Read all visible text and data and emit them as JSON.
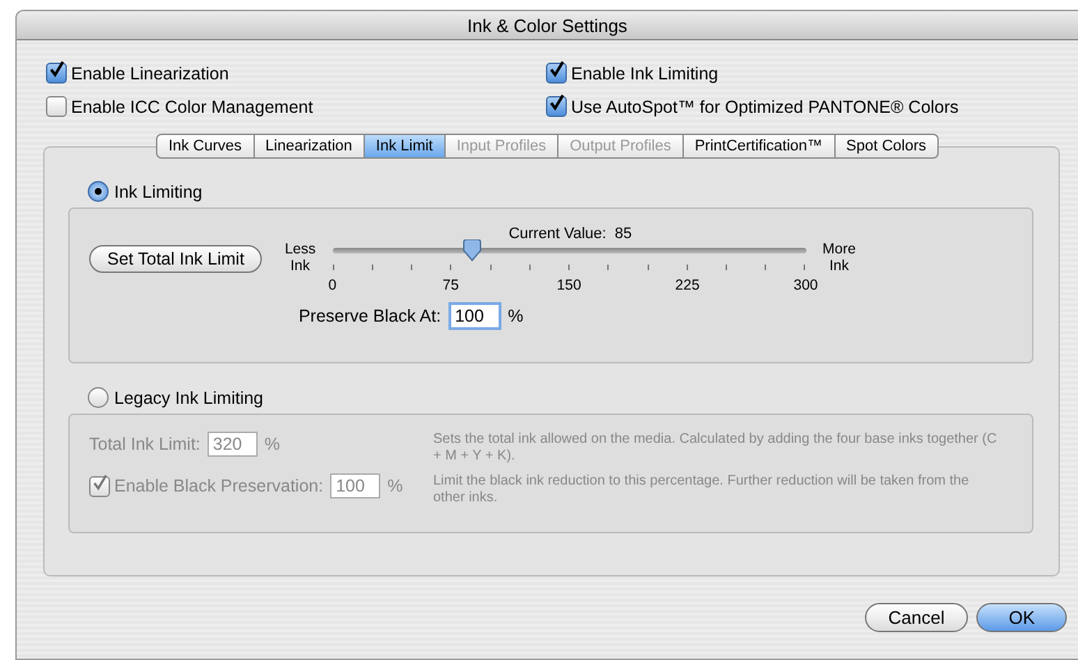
{
  "window": {
    "title": "Ink & Color Settings"
  },
  "options": [
    {
      "label": "Enable Linearization",
      "checked": true
    },
    {
      "label": "Enable Ink Limiting",
      "checked": true
    },
    {
      "label": "Enable ICC Color Management",
      "checked": false
    },
    {
      "label": "Use AutoSpot™ for Optimized PANTONE® Colors",
      "checked": true
    }
  ],
  "tabs": [
    {
      "label": "Ink Curves",
      "selected": false,
      "disabled": false
    },
    {
      "label": "Linearization",
      "selected": false,
      "disabled": false
    },
    {
      "label": "Ink Limit",
      "selected": true,
      "disabled": false
    },
    {
      "label": "Input Profiles",
      "selected": false,
      "disabled": true
    },
    {
      "label": "Output Profiles",
      "selected": false,
      "disabled": true
    },
    {
      "label": "PrintCertification™",
      "selected": false,
      "disabled": false
    },
    {
      "label": "Spot Colors",
      "selected": false,
      "disabled": false
    }
  ],
  "ink_limiting": {
    "label": "Ink Limiting",
    "selected": true,
    "button": "Set Total Ink Limit",
    "current_label": "Current Value:",
    "current_value": "85",
    "less_label": [
      "Less",
      "Ink"
    ],
    "more_label": [
      "More",
      "Ink"
    ],
    "slider": {
      "level": 0.283
    },
    "tick_labels": [
      "0",
      "75",
      "150",
      "225",
      "300"
    ],
    "preserve_label": "Preserve Black At:",
    "preserve_value": "100",
    "preserve_unit": "%"
  },
  "legacy": {
    "label": "Legacy Ink Limiting",
    "selected": false,
    "disabled": true,
    "total_label": "Total Ink Limit:",
    "total_value": "320",
    "total_unit": "%",
    "total_help": "Sets the total ink allowed on the media. Calculated by adding the four base inks together (C + M + Y + K).",
    "black_label": "Enable Black Preservation:",
    "black_checked": true,
    "black_value": "100",
    "black_unit": "%",
    "black_help": "Limit the black ink reduction to this percentage. Further reduction will be taken from the other inks."
  },
  "buttons": [
    {
      "label": "Cancel",
      "default": false
    },
    {
      "label": "OK",
      "default": true
    }
  ]
}
